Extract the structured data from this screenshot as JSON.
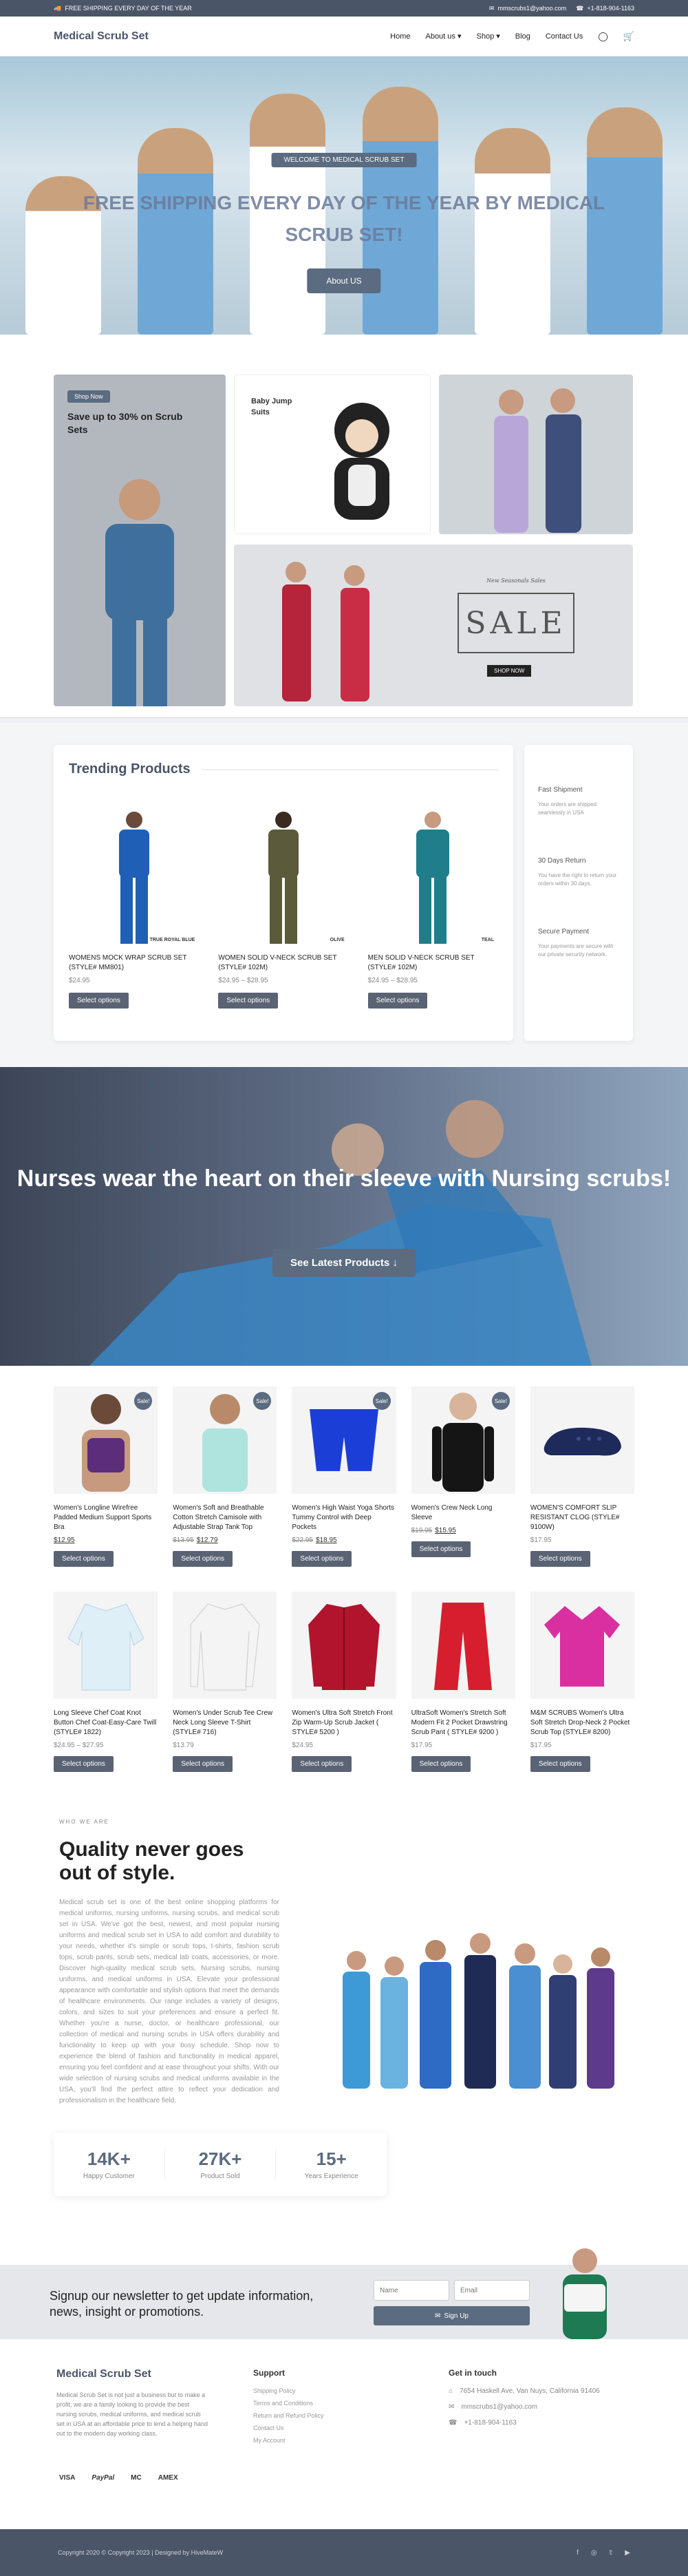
{
  "topbar": {
    "shipping": "FREE SHIPPING EVERY DAY OF THE YEAR",
    "email": "mmscrubs1@yahoo.com",
    "phone": "+1-818-904-1163"
  },
  "header": {
    "logo": "Medical Scrub Set",
    "nav": [
      "Home",
      "About us",
      "Shop",
      "Blog",
      "Contact Us"
    ]
  },
  "hero": {
    "tag": "WELCOME TO MEDICAL SCRUB SET",
    "title": "FREE SHIPPING EVERY DAY OF THE YEAR BY MEDICAL SCRUB SET!",
    "button": "About US"
  },
  "banners": {
    "shop_now": "Shop Now",
    "promo": "Save up to 30% on Scrub Sets",
    "baby": "Baby Jump Suits",
    "sale_sub": "New Seasonals Sales",
    "sale": "SALE",
    "sale_btn": "SHOP NOW"
  },
  "trending": {
    "title": "Trending Products",
    "items": [
      {
        "name": "WOMENS MOCK WRAP SCRUB SET (STYLE# MM801)",
        "price": "$24.95",
        "btn": "Select options",
        "label": "TRUE ROYAL BLUE"
      },
      {
        "name": "WOMEN SOLID V-NECK SCRUB SET (STYLE# 102M)",
        "price": "$24.95 – $28.95",
        "btn": "Select options",
        "label": "OLIVE"
      },
      {
        "name": "MEN SOLID V-NECK SCRUB SET (STYLE# 102M)",
        "price": "$24.95 – $28.95",
        "btn": "Select options",
        "label": "TEAL"
      }
    ],
    "features": [
      {
        "title": "Fast Shipment",
        "text": "Your orders are shipped seamlessly in USA"
      },
      {
        "title": "30 Days Return",
        "text": "You have the right to return your orders within 30 days."
      },
      {
        "title": "Secure Payment",
        "text": "Your payments are secure with our private security network."
      }
    ]
  },
  "nurses": {
    "title": "Nurses wear the heart on their sleeve with Nursing scrubs!",
    "cta": "See Latest Products"
  },
  "products": {
    "sale_badge": "Sale!",
    "row1": [
      {
        "name": "Women's Longline Wirefree Padded Medium Support Sports Bra",
        "price": "$12.95",
        "old": "",
        "btn": "Select options",
        "sale": true
      },
      {
        "name": "Women's Soft and Breathable Cotton Stretch Camisole with Adjustable Strap Tank Top",
        "price": "$12.79",
        "old": "$13.95",
        "btn": "Select options",
        "sale": true
      },
      {
        "name": "Women's High Waist Yoga Shorts Tummy Control with Deep Pockets",
        "price": "$18.95",
        "old": "$22.95",
        "btn": "Select options",
        "sale": true
      },
      {
        "name": "Women's Crew Neck Long Sleeve",
        "price": "$15.95",
        "old": "$19.95",
        "btn": "Select options",
        "sale": true
      },
      {
        "name": "WOMEN'S COMFORT SLIP RESISTANT CLOG (STYLE# 9100W)",
        "price": "$17.95",
        "old": "",
        "btn": "Select options",
        "sale": false
      }
    ],
    "row2": [
      {
        "name": "Long Sleeve Chef Coat Knot Button Chef Coat-Easy-Care Twill (STYLE# 1822)",
        "price": "$24.95 – $27.95",
        "btn": "Select options"
      },
      {
        "name": "Women's Under Scrub Tee Crew Neck Long Sleeve T-Shirt (STYLE# 716)",
        "price": "$13.79",
        "btn": "Select options"
      },
      {
        "name": "Women's Ultra Soft Stretch Front Zip Warm-Up Scrub Jacket ( STYLE# 5200 )",
        "price": "$24.95",
        "btn": "Select options"
      },
      {
        "name": "UltraSoft Women's Stretch Soft Modern Fit 2 Pocket Drawstring Scrub Pant ( STYLE# 9200 )",
        "price": "$17.95",
        "btn": "Select options"
      },
      {
        "name": "M&M SCRUBS Women's Ultra Soft Stretch Drop-Neck 2 Pocket Scrub Top (STYLE# 8200)",
        "price": "$17.95",
        "btn": "Select options"
      }
    ]
  },
  "quality": {
    "eyebrow": "WHO WE ARE",
    "title": "Quality never goes out of style.",
    "text": "Medical scrub set is one of the best online shopping platforms for medical uniforms, nursing uniforms, nursing scrubs, and medical scrub set in USA. We've got the best, newest, and most popular nursing uniforms and medical scrub set in USA to add comfort and durability to your needs, whether it's simple or scrub tops, t-shirts, fashion scrub tops, scrub pants, scrub sets, medical lab coats, accessories, or more. Discover high-quality medical scrub sets, Nursing scrubs, nursing uniforms, and medical uniforms in USA. Elevate your professional appearance with comfortable and stylish options that meet the demands of healthcare environments. Our range includes a variety of designs, colors, and sizes to suit your preferences and ensure a perfect fit. Whether you're a nurse, doctor, or healthcare professional, our collection of medical and nursing scrubs in USA offers durability and functionality to keep up with your busy schedule. Shop now to experience the blend of fashion and functionality in medical apparel, ensuring you feel confident and at ease throughout your shifts. With our wide selection of nursing scrubs and medical uniforms available in the USA, you'll find the perfect attire to reflect your dedication and professionalism in the healthcare field.",
    "stats": [
      {
        "num": "14K+",
        "label": "Happy Customer"
      },
      {
        "num": "27K+",
        "label": "Product Sold"
      },
      {
        "num": "15+",
        "label": "Years Experience"
      }
    ]
  },
  "newsletter": {
    "title": "Signup our newsletter to get update information, news, insight or promotions.",
    "name_ph": "Name",
    "email_ph": "Email",
    "btn": "Sign Up"
  },
  "footer": {
    "logo": "Medical Scrub Set",
    "desc": "Medical Scrub Set is not just a business but to make a profit, we are a family looking to provide the best nursing scrubs, medical uniforms, and medical scrub set in USA at an affordable price to lend a helping hand out to the modern day working class.",
    "payments": [
      "VISA",
      "PayPal",
      "MC",
      "AMEX"
    ],
    "support_title": "Support",
    "support": [
      "Shipping Policy",
      "Terms and Conditions",
      "Return and Refund Policy",
      "Contact Us",
      "My Account"
    ],
    "touch_title": "Get in touch",
    "address": "7654 Haskell Ave, Van Nuys, California 91406",
    "email": "mmscrubs1@yahoo.com",
    "phone": "+1-818-904-1163",
    "copyright": "Copyright 2020 © Copyright 2023 | Designed by HiveMateW"
  },
  "colors": {
    "accent": "#5b6b80",
    "dark": "#4a5568"
  }
}
